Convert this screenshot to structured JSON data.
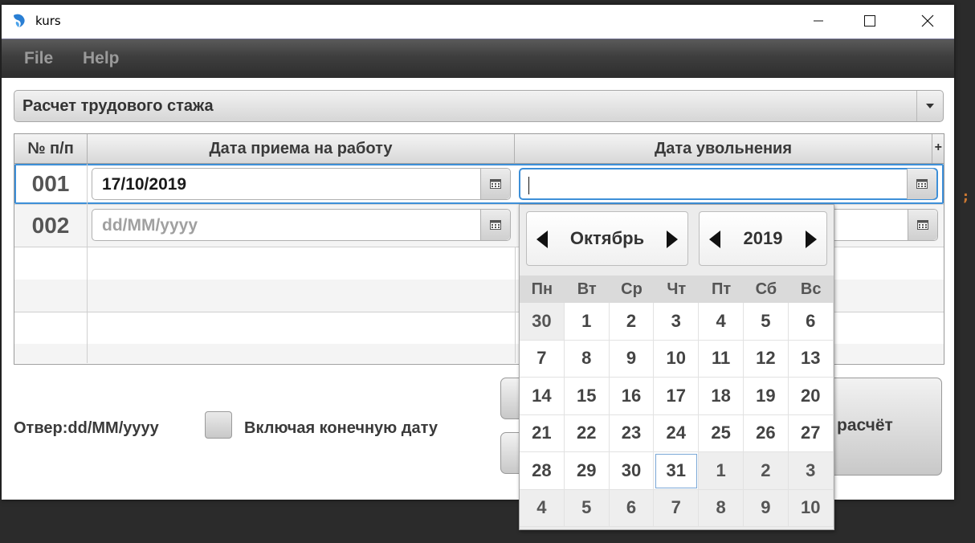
{
  "window": {
    "title": "kurs"
  },
  "menu": [
    "File",
    "Help"
  ],
  "mode_select": {
    "value": "Расчет трудового стажа"
  },
  "table": {
    "headers": [
      "№ п/п",
      "Дата приема на работу",
      "Дата увольнения"
    ],
    "add_column_label": "+",
    "rows": [
      {
        "num": "001",
        "hire_date": "17/10/2019",
        "hire_placeholder": "dd/MM/yyyy",
        "dismiss_date": ""
      },
      {
        "num": "002",
        "hire_date": "",
        "hire_placeholder": "dd/MM/yyyy",
        "dismiss_date": ""
      }
    ]
  },
  "footer": {
    "answer_label": "Отвер:dd/MM/yyyy",
    "include_end_label": "Включая конечную дату",
    "include_end_checked": false,
    "calc_button_label": "расчёт"
  },
  "calendar": {
    "month": "Октябрь",
    "year": "2019",
    "weekdays": [
      "Пн",
      "Вт",
      "Ср",
      "Чт",
      "Пт",
      "Сб",
      "Вс"
    ],
    "weeks": [
      [
        "30",
        "1",
        "2",
        "3",
        "4",
        "5",
        "6"
      ],
      [
        "7",
        "8",
        "9",
        "10",
        "11",
        "12",
        "13"
      ],
      [
        "14",
        "15",
        "16",
        "17",
        "18",
        "19",
        "20"
      ],
      [
        "21",
        "22",
        "23",
        "24",
        "25",
        "26",
        "27"
      ],
      [
        "28",
        "29",
        "30",
        "31",
        "1",
        "2",
        "3"
      ],
      [
        "4",
        "5",
        "6",
        "7",
        "8",
        "9",
        "10"
      ]
    ],
    "today": "31"
  },
  "editor_fragment": ";"
}
